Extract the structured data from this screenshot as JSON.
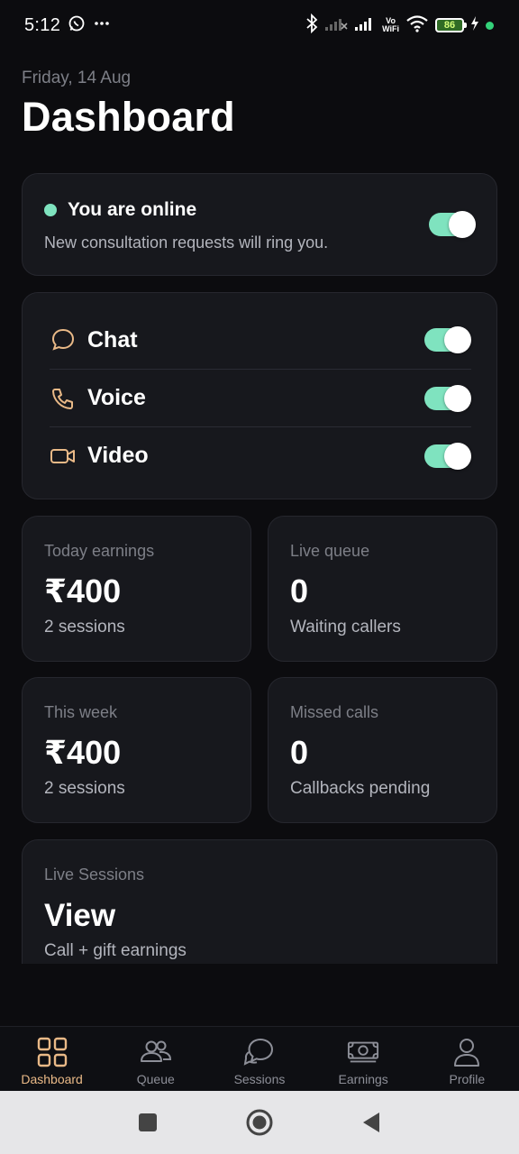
{
  "status_bar": {
    "time": "5:12",
    "battery_level": "86",
    "vowifi_line1": "Vo",
    "vowifi_line2": "WiFi",
    "icons": [
      "whatsapp-icon",
      "more-icon",
      "bluetooth-icon",
      "signal-icon",
      "wifi-icon",
      "battery-icon",
      "charging-icon"
    ]
  },
  "header": {
    "date": "Friday, 14 Aug",
    "title": "Dashboard"
  },
  "online_card": {
    "title": "You are online",
    "subtitle": "New consultation requests will ring you.",
    "toggle_on": true
  },
  "modes": [
    {
      "label": "Chat",
      "icon": "chat-icon",
      "enabled": true
    },
    {
      "label": "Voice",
      "icon": "phone-icon",
      "enabled": true
    },
    {
      "label": "Video",
      "icon": "video-icon",
      "enabled": true
    }
  ],
  "stats": [
    {
      "label": "Today earnings",
      "value": "₹400",
      "sub": "2 sessions"
    },
    {
      "label": "Live queue",
      "value": "0",
      "sub": "Waiting callers"
    },
    {
      "label": "This week",
      "value": "₹400",
      "sub": "2 sessions"
    },
    {
      "label": "Missed calls",
      "value": "0",
      "sub": "Callbacks pending"
    }
  ],
  "live_sessions": {
    "label": "Live Sessions",
    "value": "View",
    "sub": "Call + gift earnings"
  },
  "bottom_nav": [
    {
      "label": "Dashboard",
      "icon": "dashboard-grid-icon",
      "active": true
    },
    {
      "label": "Queue",
      "icon": "users-icon",
      "active": false
    },
    {
      "label": "Sessions",
      "icon": "chat-bubbles-icon",
      "active": false
    },
    {
      "label": "Earnings",
      "icon": "money-icon",
      "active": false
    },
    {
      "label": "Profile",
      "icon": "person-icon",
      "active": false
    }
  ],
  "colors": {
    "background": "#0c0c0f",
    "card": "#17181d",
    "accent_green": "#7fe3bf",
    "accent_orange": "#e9b987",
    "muted_text": "#7d7f87"
  }
}
